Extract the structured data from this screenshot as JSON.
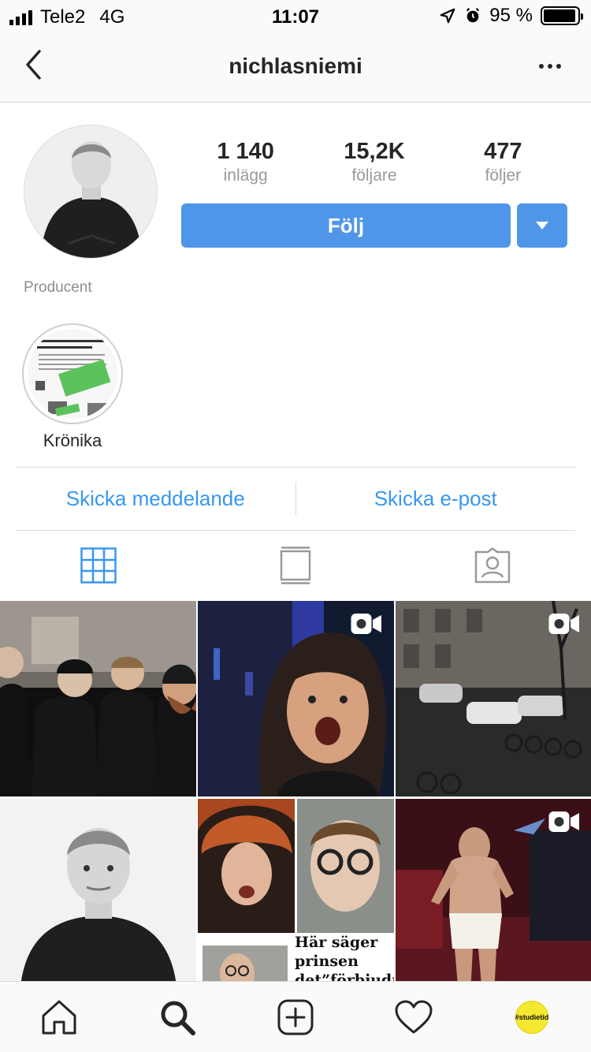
{
  "status_bar": {
    "carrier": "Tele2",
    "network": "4G",
    "time": "11:07",
    "battery_percent": "95 %",
    "battery_level": 0.95,
    "icons": [
      "signal-icon",
      "location-arrow-icon",
      "alarm-icon",
      "battery-icon"
    ]
  },
  "nav": {
    "title": "nichlasniemi",
    "back_icon": "chevron-left-icon",
    "more_icon": "more-dots-icon"
  },
  "profile": {
    "stats": [
      {
        "value": "1 140",
        "label": "inlägg"
      },
      {
        "value": "15,2K",
        "label": "följare"
      },
      {
        "value": "477",
        "label": "följer"
      }
    ],
    "follow_label": "Följ",
    "bio": "Producent",
    "accent_color": "#4f96e8"
  },
  "highlights": [
    {
      "label": "Krönika"
    }
  ],
  "contact": {
    "message_label": "Skicka meddelande",
    "email_label": "Skicka e-post",
    "link_color": "#3897f0"
  },
  "tabs": [
    {
      "icon": "grid-icon",
      "active": true
    },
    {
      "icon": "feed-icon",
      "active": false
    },
    {
      "icon": "tagged-icon",
      "active": false
    }
  ],
  "grid": {
    "posts": [
      {
        "type": "photo"
      },
      {
        "type": "video"
      },
      {
        "type": "video"
      },
      {
        "type": "photo"
      },
      {
        "type": "photo",
        "caption": "Här säger prinsen det”förbjudna”"
      },
      {
        "type": "video"
      }
    ]
  },
  "tabbar": {
    "items": [
      "home-icon",
      "search-icon",
      "new-post-icon",
      "activity-heart-icon",
      "profile-avatar"
    ],
    "profile_avatar_text": "#studietid"
  }
}
